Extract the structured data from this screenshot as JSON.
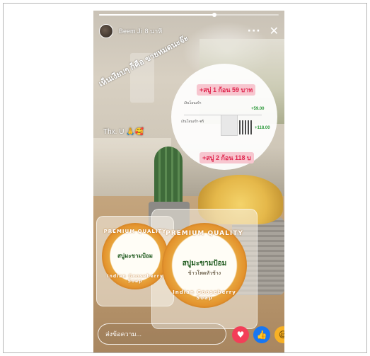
{
  "story": {
    "user_name": "Beem Ji",
    "post_time": "8 นาที",
    "progress_fraction": 0.64,
    "more_icon": "more-dots-icon",
    "close_icon": "close-icon"
  },
  "overlay": {
    "caption": "เห็นเงียบๆ ก็คือ ขายหมดนะจ๊ะ",
    "thanks": "Thx. U 🙏🥰",
    "sticker_one": "+สบู่ 1 ก้อน 59 บาท",
    "sticker_two": "+สบู่ 2 ก้อน 118 บ",
    "tx1_label": "เงินโอนเข้า",
    "tx1_amount": "+59.00",
    "tx2_label": "เงินโอนเข้า-พร้",
    "tx2_amount": "+118.00"
  },
  "product": {
    "ring_text": "PREMIUM QUALITY",
    "name": "สบู่มะขามป้อม",
    "sub": "ข้าวโพดหัวช้าง",
    "ring_bottom": "Indian Gooseberry Soap"
  },
  "reply": {
    "placeholder": "ส่งข้อความ..."
  },
  "reactions": {
    "heart_icon": "heart-icon",
    "like_icon": "thumbs-up-icon",
    "haha_icon": "laughing-emoji-icon"
  },
  "colors": {
    "sticker_bg": "#f7c6cf",
    "sticker_text": "#e0274f",
    "heart": "#f33e58",
    "like": "#1877f2",
    "haha": "#f7b125"
  }
}
